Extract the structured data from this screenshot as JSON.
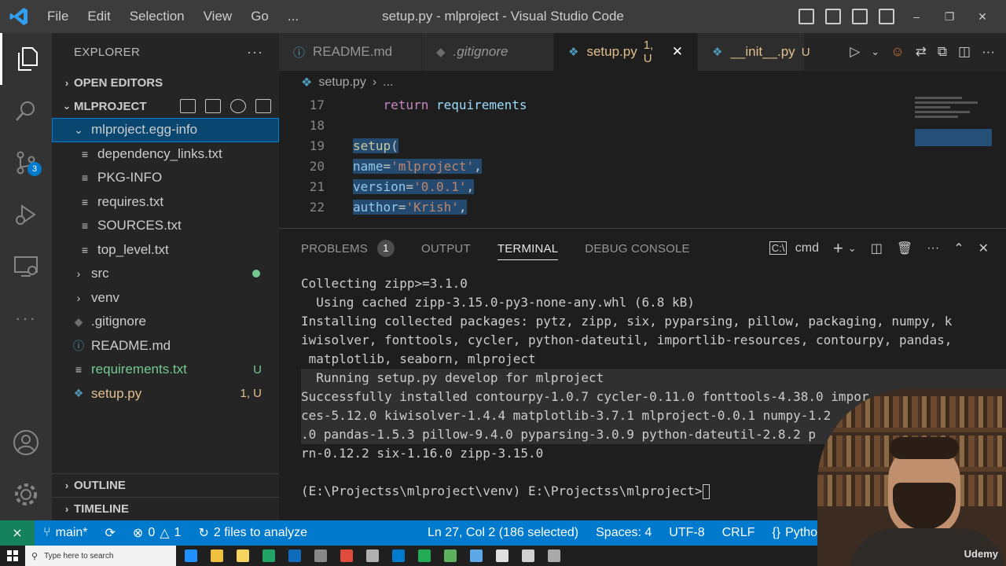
{
  "window": {
    "title": "setup.py - mlproject - Visual Studio Code",
    "menu": [
      "File",
      "Edit",
      "Selection",
      "View",
      "Go",
      "..."
    ]
  },
  "activity": {
    "scm_badge": "3"
  },
  "sidebar": {
    "header": "EXPLORER",
    "open_editors": "OPEN EDITORS",
    "project": "MLPROJECT",
    "tree": [
      {
        "label": "mlproject.egg-info",
        "icon": "chevron-down",
        "indent": 1,
        "selected": true,
        "status": ""
      },
      {
        "label": "dependency_links.txt",
        "icon": "lines",
        "indent": 2,
        "status": ""
      },
      {
        "label": "PKG-INFO",
        "icon": "lines",
        "indent": 2,
        "status": ""
      },
      {
        "label": "requires.txt",
        "icon": "lines",
        "indent": 2,
        "status": ""
      },
      {
        "label": "SOURCES.txt",
        "icon": "lines",
        "indent": 2,
        "status": ""
      },
      {
        "label": "top_level.txt",
        "icon": "lines",
        "indent": 2,
        "status": ""
      },
      {
        "label": "src",
        "icon": "chevron-right",
        "indent": 1,
        "status": "dot"
      },
      {
        "label": "venv",
        "icon": "chevron-right",
        "indent": 1,
        "status": ""
      },
      {
        "label": ".gitignore",
        "icon": "diamond",
        "indent": 1,
        "status": ""
      },
      {
        "label": "README.md",
        "icon": "info",
        "indent": 1,
        "status": ""
      },
      {
        "label": "requirements.txt",
        "icon": "lines",
        "indent": 1,
        "status": "U",
        "color": "green"
      },
      {
        "label": "setup.py",
        "icon": "python",
        "indent": 1,
        "status": "1, U",
        "color": "yellow"
      }
    ],
    "outline": "OUTLINE",
    "timeline": "TIMELINE"
  },
  "tabs": [
    {
      "label": "README.md",
      "icon": "ⓘ"
    },
    {
      "label": ".gitignore",
      "icon": "◆"
    },
    {
      "label": "setup.py",
      "suffix": "1, U",
      "icon": "❖",
      "active": true
    },
    {
      "label": "__init__.py",
      "suffix": "U",
      "icon": "❖"
    }
  ],
  "breadcrumb": {
    "file": "setup.py",
    "rest": "..."
  },
  "code": [
    {
      "ln": "17",
      "parts": [
        [
          "",
          "    "
        ],
        [
          "kw",
          "return"
        ],
        [
          "",
          " "
        ],
        [
          "var",
          "requirements"
        ]
      ]
    },
    {
      "ln": "18",
      "parts": []
    },
    {
      "ln": "19",
      "parts": [
        [
          "fn",
          "setup"
        ],
        [
          "",
          "("
        ]
      ],
      "selected": true
    },
    {
      "ln": "20",
      "parts": [
        [
          "var",
          "name"
        ],
        [
          "",
          "="
        ],
        [
          "str",
          "'mlproject'"
        ],
        [
          "",
          ","
        ]
      ],
      "selected": true
    },
    {
      "ln": "21",
      "parts": [
        [
          "var",
          "version"
        ],
        [
          "",
          "="
        ],
        [
          "str",
          "'0.0.1'"
        ],
        [
          "",
          ","
        ]
      ],
      "selected": true
    },
    {
      "ln": "22",
      "parts": [
        [
          "var",
          "author"
        ],
        [
          "",
          "="
        ],
        [
          "str",
          "'Krish'"
        ],
        [
          "",
          ","
        ]
      ],
      "selected": true
    }
  ],
  "panel": {
    "tabs": [
      "PROBLEMS",
      "OUTPUT",
      "TERMINAL",
      "DEBUG CONSOLE"
    ],
    "problems_count": "1",
    "shell": "cmd",
    "terminal": [
      "Collecting zipp>=3.1.0",
      "  Using cached zipp-3.15.0-py3-none-any.whl (6.8 kB)",
      "Installing collected packages: pytz, zipp, six, pyparsing, pillow, packaging, numpy, k",
      "iwisolver, fonttools, cycler, python-dateutil, importlib-resources, contourpy, pandas,",
      " matplotlib, seaborn, mlproject",
      "  Running setup.py develop for mlproject",
      "Successfully installed contourpy-1.0.7 cycler-0.11.0 fonttools-4.38.0 impor",
      "ces-5.12.0 kiwisolver-1.4.4 matplotlib-3.7.1 mlproject-0.0.1 numpy-1.2",
      ".0 pandas-1.5.3 pillow-9.4.0 pyparsing-3.0.9 python-dateutil-2.8.2 p",
      "rn-0.12.2 six-1.16.0 zipp-3.15.0",
      "",
      "(E:\\Projectss\\mlproject\\venv) E:\\Projectss\\mlproject>"
    ]
  },
  "status": {
    "branch": "main*",
    "errors": "0",
    "warnings": "1",
    "analyze": "2 files to analyze",
    "position": "Ln 27, Col 2 (186 selected)",
    "spaces": "Spaces: 4",
    "encoding": "UTF-8",
    "eol": "CRLF",
    "language": "Pytho"
  },
  "taskbar": {
    "search_placeholder": "Type here to search",
    "colors": [
      "#1e90ff",
      "#f0c040",
      "#f4d35e",
      "#21a366",
      "#0f6cbd",
      "#888888",
      "#e04b3a",
      "#b0b0b0",
      "#007acc",
      "#22aa55",
      "#5db05d",
      "#5fa8e8",
      "#e0e0e0",
      "#d0d0d0",
      "#aaaaaa"
    ]
  },
  "webcam": {
    "brand": "Udemy"
  },
  "colors": {
    "accent": "#007acc",
    "statusbar": "#007acc",
    "remote": "#16825d",
    "untracked": "#73c991",
    "modified": "#e2c08d"
  }
}
